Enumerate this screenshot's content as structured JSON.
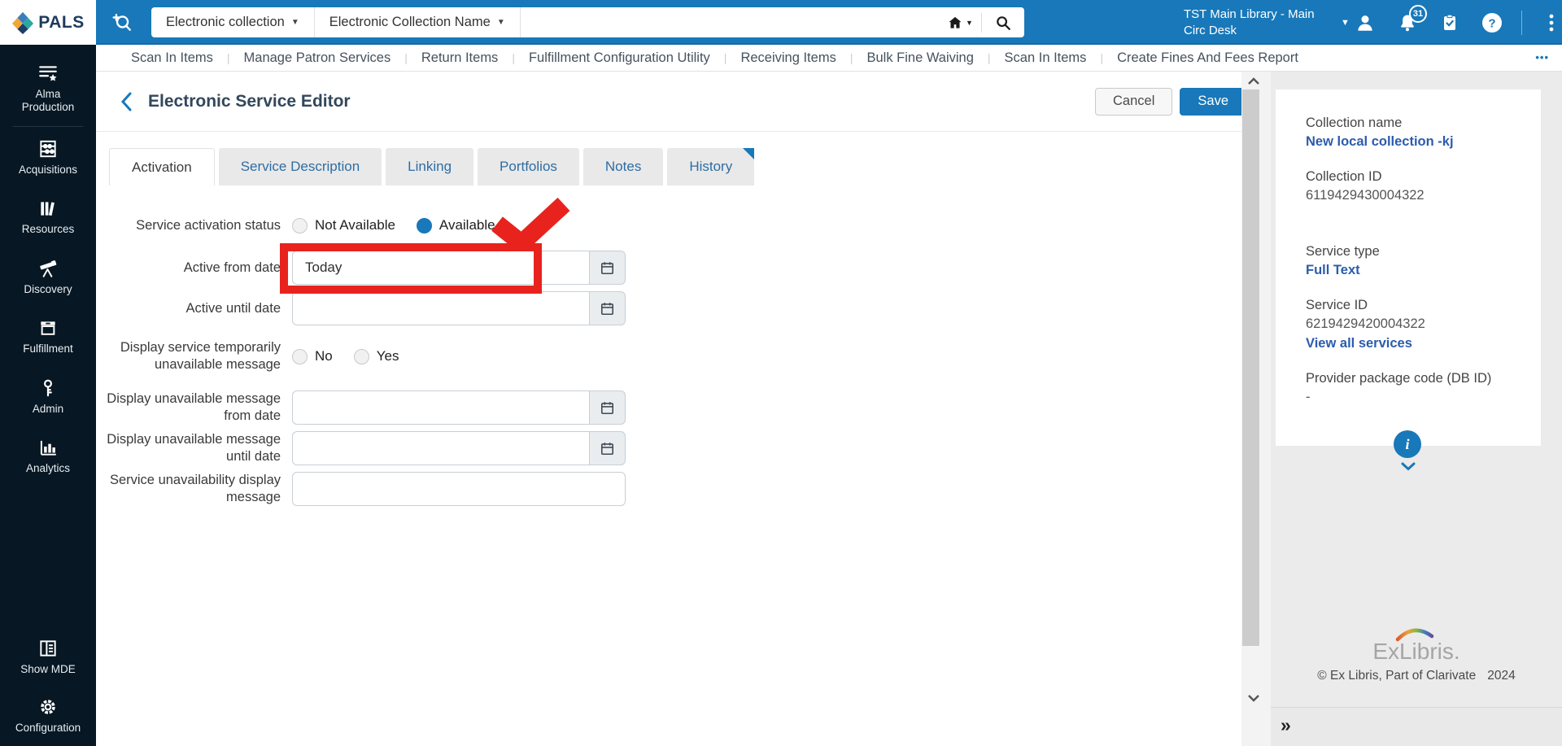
{
  "topbar": {
    "logo_text": "PALS",
    "scope_dropdown": "Electronic collection",
    "field_dropdown": "Electronic Collection Name",
    "search_value": "",
    "location_line1": "TST Main Library - Main",
    "location_line2": "Circ Desk",
    "notification_count": "31"
  },
  "quicklinks": {
    "items": [
      "Scan In Items",
      "Manage Patron Services",
      "Return Items",
      "Fulfillment Configuration Utility",
      "Receiving Items",
      "Bulk Fine Waiving",
      "Scan In Items",
      "Create Fines And Fees Report"
    ],
    "more_label": "•••"
  },
  "sidebar": {
    "items": [
      {
        "label": "Alma Production",
        "icon": "alma-production-icon"
      },
      {
        "label": "Acquisitions",
        "icon": "acquisitions-icon"
      },
      {
        "label": "Resources",
        "icon": "resources-icon"
      },
      {
        "label": "Discovery",
        "icon": "discovery-icon"
      },
      {
        "label": "Fulfillment",
        "icon": "fulfillment-icon"
      },
      {
        "label": "Admin",
        "icon": "admin-icon"
      },
      {
        "label": "Analytics",
        "icon": "analytics-icon"
      },
      {
        "label": "Show MDE",
        "icon": "show-mde-icon"
      },
      {
        "label": "Configuration",
        "icon": "configuration-icon"
      }
    ]
  },
  "page": {
    "title": "Electronic Service Editor",
    "cancel_label": "Cancel",
    "save_label": "Save"
  },
  "tabs": [
    {
      "label": "Activation",
      "active": true
    },
    {
      "label": "Service Description",
      "active": false
    },
    {
      "label": "Linking",
      "active": false
    },
    {
      "label": "Portfolios",
      "active": false
    },
    {
      "label": "Notes",
      "active": false
    },
    {
      "label": "History",
      "active": false
    }
  ],
  "form": {
    "activation_status": {
      "label": "Service activation status",
      "options": [
        "Not Available",
        "Available"
      ],
      "selected": "Available"
    },
    "active_from": {
      "label": "Active from date",
      "value": "Today"
    },
    "active_until": {
      "label": "Active until date",
      "value": ""
    },
    "temp_unavailable": {
      "label": "Display service temporarily unavailable message",
      "options": [
        "No",
        "Yes"
      ],
      "selected": ""
    },
    "unavail_from": {
      "label": "Display unavailable message from date",
      "value": ""
    },
    "unavail_until": {
      "label": "Display unavailable message until date",
      "value": ""
    },
    "unavail_message": {
      "label": "Service unavailability display message",
      "value": ""
    }
  },
  "details_panel": {
    "collection_name_label": "Collection name",
    "collection_name": "New local collection -kj",
    "collection_id_label": "Collection ID",
    "collection_id": "6119429430004322",
    "service_type_label": "Service type",
    "service_type": "Full Text",
    "service_id_label": "Service ID",
    "service_id": "6219429420004322",
    "view_all_services": "View all services",
    "provider_label": "Provider package code (DB ID)",
    "provider_value": "-"
  },
  "footer": {
    "brand": "ExLibris.",
    "copyright": "© Ex Libris, Part of Clarivate",
    "year": "2024",
    "expand_label": "»"
  },
  "colors": {
    "accent": "#1878b9",
    "annotation_red": "#e8231d",
    "sidebar_bg": "#071723",
    "link_blue": "#2b5cad"
  }
}
